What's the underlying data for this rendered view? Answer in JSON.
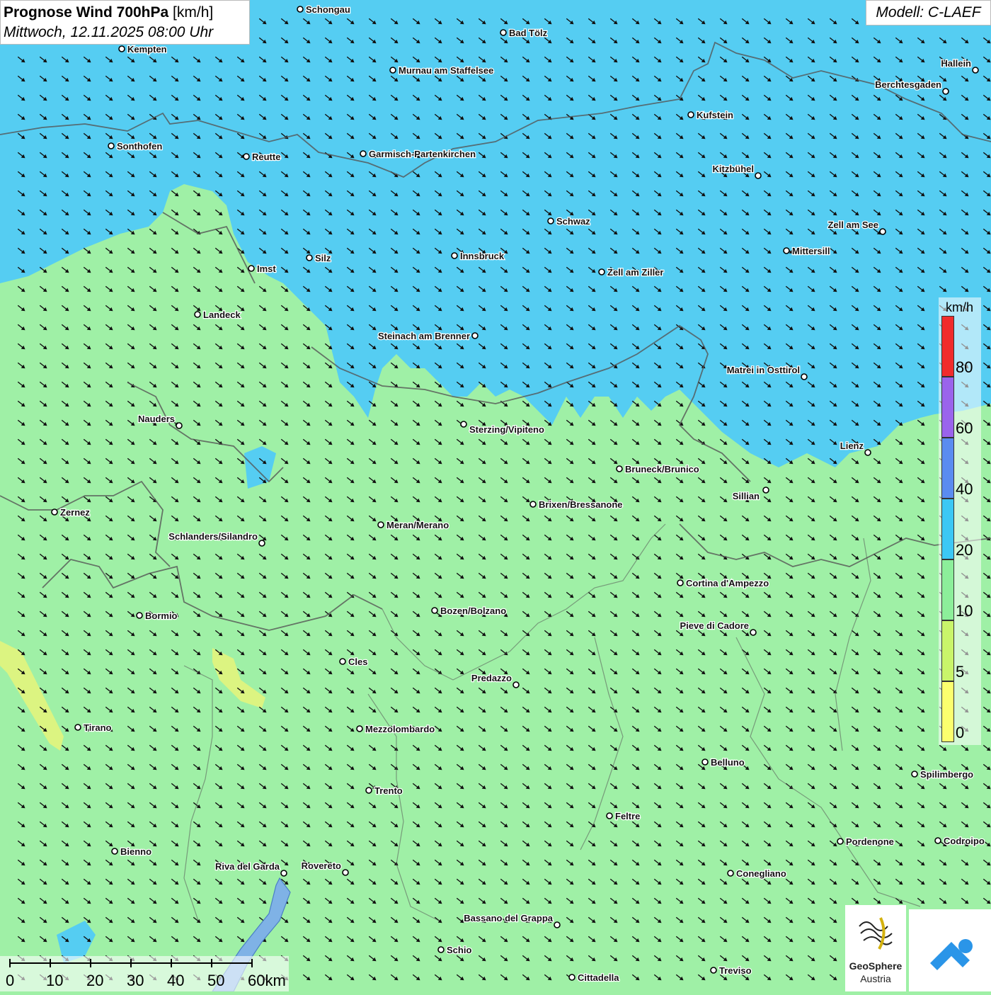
{
  "header": {
    "title_bold": "Prognose Wind 700hPa",
    "title_unit": "[km/h]",
    "datetime": "Mittwoch, 12.11.2025 08:00 Uhr"
  },
  "model": "Modell: C-LAEF",
  "legend": {
    "unit": "km/h",
    "classes": [
      {
        "label": "0",
        "color": "#fbff6e"
      },
      {
        "label": "5",
        "color": "#c9f56a"
      },
      {
        "label": "10",
        "color": "#8cef9a"
      },
      {
        "label": "20",
        "color": "#3cc8f4"
      },
      {
        "label": "40",
        "color": "#5a8cf0"
      },
      {
        "label": "60",
        "color": "#9a64ec"
      },
      {
        "label": "80",
        "color": "#f02c2c"
      }
    ]
  },
  "scalebar": {
    "labels": [
      "0",
      "10",
      "20",
      "30",
      "40",
      "50",
      "60km"
    ]
  },
  "cities": [
    {
      "name": "Schongau"
    },
    {
      "name": "Bad Tölz"
    },
    {
      "name": "Kempten"
    },
    {
      "name": "Murnau am Staffelsee"
    },
    {
      "name": "Hallein"
    },
    {
      "name": "Berchtesgaden"
    },
    {
      "name": "Kufstein"
    },
    {
      "name": "Sonthofen"
    },
    {
      "name": "Reutte"
    },
    {
      "name": "Garmisch-Partenkirchen"
    },
    {
      "name": "Kitzbühel"
    },
    {
      "name": "Schwaz"
    },
    {
      "name": "Zell am See"
    },
    {
      "name": "Mittersill"
    },
    {
      "name": "Innsbruck"
    },
    {
      "name": "Silz"
    },
    {
      "name": "Imst"
    },
    {
      "name": "Zell am Ziller"
    },
    {
      "name": "Landeck"
    },
    {
      "name": "Steinach am Brenner"
    },
    {
      "name": "Matrei in Osttirol"
    },
    {
      "name": "Nauders"
    },
    {
      "name": "Sterzing/Vipiteno"
    },
    {
      "name": "Lienz"
    },
    {
      "name": "Bruneck/Brunico"
    },
    {
      "name": "Sillian"
    },
    {
      "name": "Zernez"
    },
    {
      "name": "Brixen/Bressanone"
    },
    {
      "name": "Meran/Merano"
    },
    {
      "name": "Schlanders/Silandro"
    },
    {
      "name": "Cortina d'Ampezzo"
    },
    {
      "name": "Bormio"
    },
    {
      "name": "Bozen/Bolzano"
    },
    {
      "name": "Pieve di Cadore"
    },
    {
      "name": "Cles"
    },
    {
      "name": "Predazzo"
    },
    {
      "name": "Tirano"
    },
    {
      "name": "Mezzolombardo"
    },
    {
      "name": "Belluno"
    },
    {
      "name": "Spilimbergo"
    },
    {
      "name": "Trento"
    },
    {
      "name": "Feltre"
    },
    {
      "name": "Bienno"
    },
    {
      "name": "Pordenone"
    },
    {
      "name": "Codroipo"
    },
    {
      "name": "Riva del Garda"
    },
    {
      "name": "Rovereto"
    },
    {
      "name": "Conegliano"
    },
    {
      "name": "Bassano del Grappa"
    },
    {
      "name": "Schio"
    },
    {
      "name": "Treviso"
    },
    {
      "name": "Cittadella"
    }
  ],
  "logos": {
    "geosphere_line1": "GeoSphere",
    "geosphere_line2": "Austria"
  },
  "colors": {
    "wind_10_20": "#9ff0a6",
    "wind_20_40": "#55cdf2",
    "border": "#555555"
  }
}
